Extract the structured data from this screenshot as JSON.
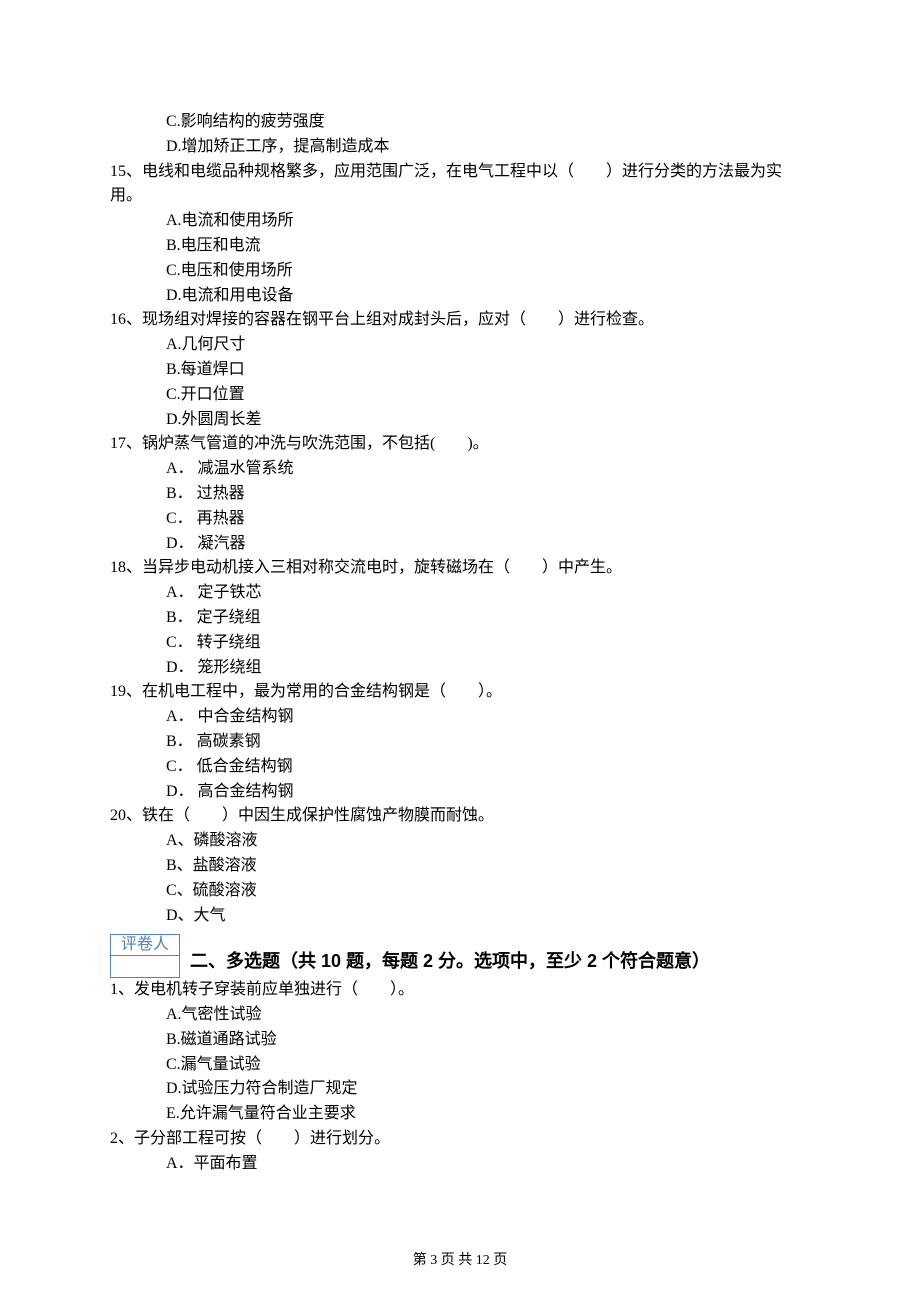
{
  "partial_options": {
    "c": "C.影响结构的疲劳强度",
    "d": "D.增加矫正工序，提高制造成本"
  },
  "questions": [
    {
      "num": "15、",
      "text": "电线和电缆品种规格繁多，应用范围广泛，在电气工程中以（　　）进行分类的方法最为实用。",
      "opts": [
        "A.电流和使用场所",
        "B.电压和电流",
        "C.电压和使用场所",
        "D.电流和用电设备"
      ]
    },
    {
      "num": "16、",
      "text": "现场组对焊接的容器在钢平台上组对成封头后，应对（　　）进行检查。",
      "opts": [
        "A.几何尺寸",
        "B.每道焊口",
        "C.开口位置",
        "D.外圆周长差"
      ]
    },
    {
      "num": "17、",
      "text": "锅炉蒸气管道的冲洗与吹洗范围，不包括(　　)。",
      "opts": [
        "A． 减温水管系统",
        "B． 过热器",
        "C． 再热器",
        "D． 凝汽器"
      ]
    },
    {
      "num": "18、",
      "text": "当异步电动机接入三相对称交流电时，旋转磁场在（　　）中产生。",
      "opts": [
        "A． 定子铁芯",
        "B． 定子绕组",
        "C． 转子绕组",
        "D． 笼形绕组"
      ]
    },
    {
      "num": "19、",
      "text": "在机电工程中，最为常用的合金结构钢是（　　）。",
      "opts": [
        "A． 中合金结构钢",
        "B． 高碳素钢",
        "C． 低合金结构钢",
        "D． 高合金结构钢"
      ]
    },
    {
      "num": "20、",
      "text": "铁在（　　）中因生成保护性腐蚀产物膜而耐蚀。",
      "opts": [
        "A、磷酸溶液",
        "B、盐酸溶液",
        "C、硫酸溶液",
        "D、大气"
      ]
    }
  ],
  "grader_label": "评卷人",
  "section2_title": "二、多选题（共 10 题，每题 2 分。选项中，至少 2 个符合题意）",
  "questions2": [
    {
      "num": "1、",
      "text": "发电机转子穿装前应单独进行（　　）。",
      "opts": [
        "A.气密性试验",
        "B.磁道通路试验",
        "C.漏气量试验",
        "D.试验压力符合制造厂规定",
        "E.允许漏气量符合业主要求"
      ]
    },
    {
      "num": "2、",
      "text": "子分部工程可按（　　）进行划分。",
      "opts": [
        "A．平面布置"
      ]
    }
  ],
  "footer": "第 3 页 共 12 页"
}
